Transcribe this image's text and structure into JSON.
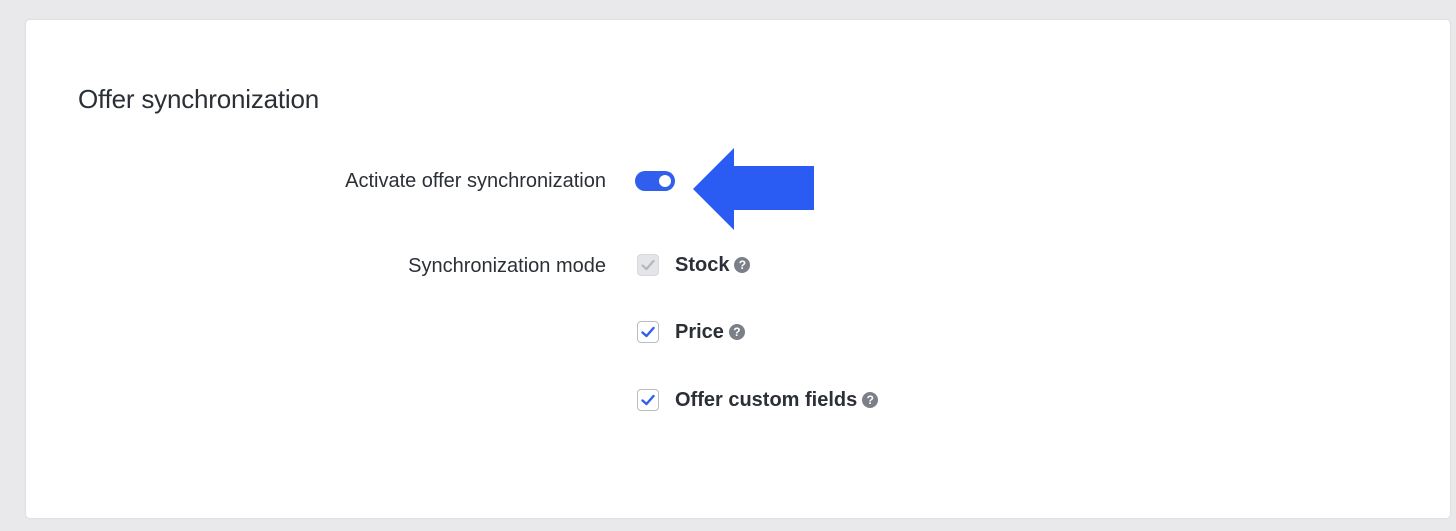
{
  "section": {
    "title": "Offer synchronization"
  },
  "activate": {
    "label": "Activate offer synchronization",
    "enabled": true
  },
  "mode": {
    "label": "Synchronization mode",
    "options": [
      {
        "label": "Stock",
        "checked": true,
        "disabled": true
      },
      {
        "label": "Price",
        "checked": true,
        "disabled": false
      },
      {
        "label": "Offer custom fields",
        "checked": true,
        "disabled": false
      }
    ]
  },
  "icons": {
    "help": "?"
  },
  "colors": {
    "accent": "#2f5fec",
    "arrow": "#2a5cf3",
    "text": "#2b2f36",
    "help_icon": "#7b8088",
    "disabled_check": "#b3b6bb"
  }
}
